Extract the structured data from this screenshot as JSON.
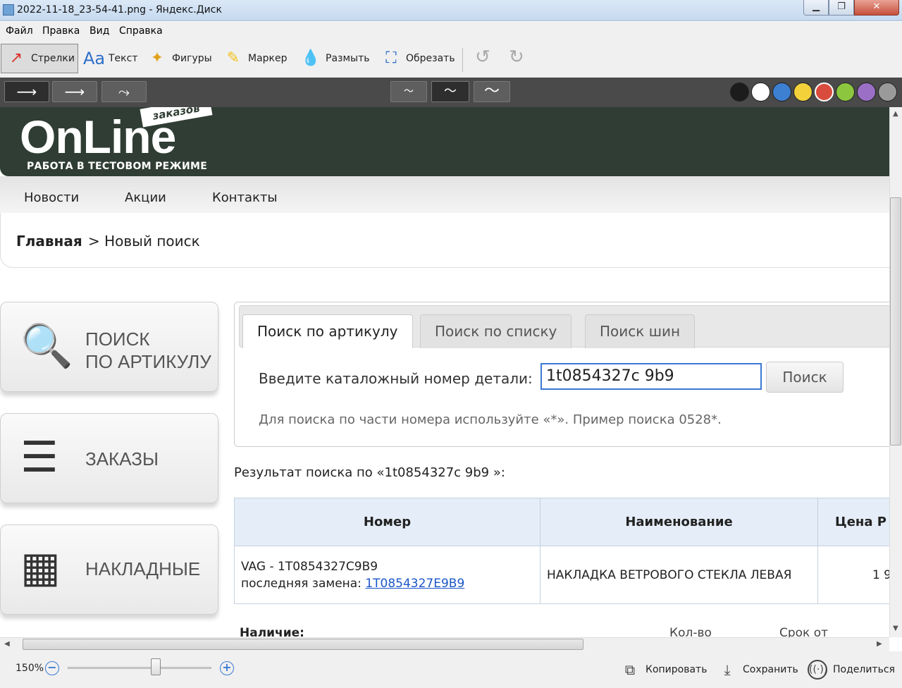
{
  "window": {
    "title": "2022-11-18_23-54-41.png - Яндекс.Диск",
    "minimize": "▁",
    "maximize": "❐",
    "close": "✕"
  },
  "menu": [
    "Файл",
    "Правка",
    "Вид",
    "Справка"
  ],
  "toolbar": {
    "tools": [
      {
        "label": "Стрелки",
        "icon": "arrow-icon"
      },
      {
        "label": "Текст",
        "icon": "text-icon"
      },
      {
        "label": "Фигуры",
        "icon": "shapes-icon"
      },
      {
        "label": "Маркер",
        "icon": "marker-icon"
      },
      {
        "label": "Размыть",
        "icon": "blur-icon"
      },
      {
        "label": "Обрезать",
        "icon": "crop-icon"
      }
    ],
    "undo_glyph": "↺",
    "redo_glyph": "↻"
  },
  "subbar": {
    "arrow_styles": [
      "⟶",
      "⟶",
      "⤳"
    ],
    "line_styles": [
      "～",
      "～",
      "～"
    ],
    "colors": [
      "#1c1c1c",
      "#ffffff",
      "#3d7fd1",
      "#f2d13b",
      "#d94c3d",
      "#8cc63f",
      "#9b6fc6",
      "#9a9a9a"
    ]
  },
  "site": {
    "logo": "OnLine",
    "logo_tag": "заказов",
    "logo_sub": "РАБОТА В ТЕСТОВОМ РЕЖИМЕ",
    "nav": [
      "Новости",
      "Акции",
      "Контакты"
    ],
    "breadcrumb": {
      "home": "Главная",
      "current": "> Новый поиск"
    },
    "side_buttons": [
      {
        "line1": "ПОИСК",
        "line2": "ПО АРТИКУЛУ",
        "icon": "🔍"
      },
      {
        "line1": "ЗАКАЗЫ",
        "line2": "",
        "icon": "☰"
      },
      {
        "line1": "НАКЛАДНЫЕ",
        "line2": "",
        "icon": "▦"
      }
    ],
    "tabs": [
      "Поиск по артикулу",
      "Поиск по списку",
      "Поиск шин"
    ],
    "search_label": "Введите каталожный номер детали:",
    "search_value": "1t0854327c 9b9",
    "search_button": "Поиск",
    "hint": "Для поиска по части номера используйте «*». Пример поиска 0528*.",
    "result_title": "Результат поиска по «1t0854327c 9b9 »:",
    "table": {
      "headers": [
        "Номер",
        "Наименование",
        "Цена Р"
      ],
      "rows": [
        {
          "number_line1": "VAG - 1T0854327C9B9",
          "number_line2_prefix": "последняя замена: ",
          "replacement": "1T0854327E9B9",
          "name": "НАКЛАДКА ВЕТРОВОГО СТЕКЛА ЛЕВАЯ",
          "price": "1 9"
        }
      ]
    },
    "availability_label": "Наличие:",
    "qty_label": "Кол-во",
    "term_label": "Срок от"
  },
  "status": {
    "zoom": "150%",
    "zoom_minus": "−",
    "zoom_plus": "+",
    "copy": "Копировать",
    "save": "Сохранить",
    "share": "Поделиться"
  }
}
